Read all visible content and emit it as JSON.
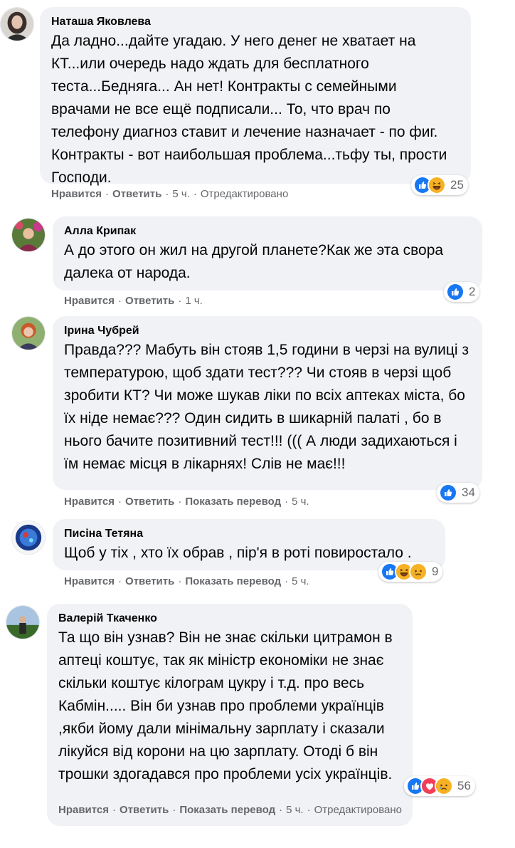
{
  "colors": {
    "bubble": "#f0f2f5",
    "secondary_text": "#65676b",
    "like_blue": "#1877f2",
    "love_red": "#f33e58",
    "haha_yellow": "#f7b125"
  },
  "separator": "·",
  "comments": [
    {
      "author": "Наташа Яковлева",
      "text": "Да ладно...дайте угадаю. У него денег не хватает на КТ...или очередь надо ждать для бесплатного теста...Бедняга... Ан нет! Контракты с семейными врачами не все ещё подписали... То, что врач по телефону диагноз ставит и лечение назначает - по фиг. Контракты - вот наибольшая проблема...тьфу ты, прости Господи.",
      "reactions": [
        "like-icon",
        "haha-icon"
      ],
      "reaction_count": "25",
      "like_label": "Нравится",
      "reply_label": "Ответить",
      "time": "5 ч.",
      "edited": "Отредактировано"
    },
    {
      "author": "Алла Крипак",
      "text": "А до этого он жил на другой планете?Как же эта свора далека от народа.",
      "reactions": [
        "like-icon"
      ],
      "reaction_count": "2",
      "like_label": "Нравится",
      "reply_label": "Ответить",
      "time": "1 ч."
    },
    {
      "author": "Ірина Чубрей",
      "text": "Правда??? Мабуть він стояв 1,5 години в черзі на вулиці з температурою, щоб здати тест??? Чи стояв в черзі щоб зробити КТ? Чи може шукав ліки по всіх аптеках міста, бо їх ніде немає??? Один сидить в шикарній палаті , бо в нього бачите позитивний тест!!! ((( А люди задихаються і їм немає місця в лікарнях! Слів не має!!!",
      "reactions": [
        "like-icon"
      ],
      "reaction_count": "34",
      "like_label": "Нравится",
      "reply_label": "Ответить",
      "translate_label": "Показать перевод",
      "time": "5 ч."
    },
    {
      "author": "Писіна Тетяна",
      "text": "Щоб у тіх , хто їх обрав , пір'я в роті повиростало .",
      "reactions": [
        "like-icon",
        "haha-icon",
        "sad-icon"
      ],
      "reaction_count": "9",
      "like_label": "Нравится",
      "reply_label": "Ответить",
      "translate_label": "Показать перевод",
      "time": "5 ч."
    },
    {
      "author": "Валерій Ткаченко",
      "text": "Та що він узнав? Він не знає скільки цитрамон в аптеці коштує, так як міністр економіки не знає скільки коштує кілограм цукру і т.д. про весь Кабмін..... Він би узнав про проблеми українців ,якби йому дали мінімальну зарплату і сказали лікуйся від корони на цю зарплату. Отоді б він трошки здогадався про проблеми усіх українців.",
      "reactions": [
        "like-icon",
        "love-icon",
        "sad-icon"
      ],
      "reaction_count": "56",
      "like_label": "Нравится",
      "reply_label": "Ответить",
      "translate_label": "Показать перевод",
      "time": "5 ч.",
      "edited": "Отредактировано"
    }
  ]
}
